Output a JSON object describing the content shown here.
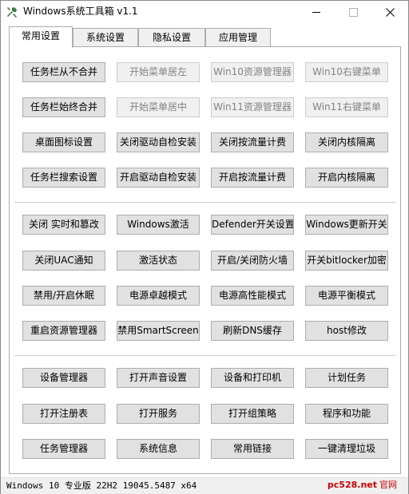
{
  "window": {
    "title": "Windows系统工具箱 v1.1"
  },
  "tabs": [
    {
      "label": "常用设置",
      "active": true
    },
    {
      "label": "系统设置",
      "active": false
    },
    {
      "label": "隐私设置",
      "active": false
    },
    {
      "label": "应用管理",
      "active": false
    }
  ],
  "buttons": {
    "g1": [
      {
        "label": "任务栏从不合并",
        "enabled": true
      },
      {
        "label": "开始菜单居左",
        "enabled": false
      },
      {
        "label": "Win10资源管理器",
        "enabled": false
      },
      {
        "label": "Win10右键菜单",
        "enabled": false
      },
      {
        "label": "任务栏始终合并",
        "enabled": true
      },
      {
        "label": "开始菜单居中",
        "enabled": false
      },
      {
        "label": "Win11资源管理器",
        "enabled": false
      },
      {
        "label": "Win11右键菜单",
        "enabled": false
      },
      {
        "label": "桌面图标设置",
        "enabled": true
      },
      {
        "label": "关闭驱动自检安装",
        "enabled": true
      },
      {
        "label": "关闭按流量计费",
        "enabled": true
      },
      {
        "label": "关闭内核隔离",
        "enabled": true
      },
      {
        "label": "任务栏搜索设置",
        "enabled": true
      },
      {
        "label": "开启驱动自检安装",
        "enabled": true
      },
      {
        "label": "开启按流量计费",
        "enabled": true
      },
      {
        "label": "开启内核隔离",
        "enabled": true
      }
    ],
    "g2": [
      {
        "label": "关闭 实时和篡改",
        "enabled": true
      },
      {
        "label": "Windows激活",
        "enabled": true
      },
      {
        "label": "Defender开关设置",
        "enabled": true
      },
      {
        "label": "Windows更新开关",
        "enabled": true
      },
      {
        "label": "关闭UAC通知",
        "enabled": true
      },
      {
        "label": "激活状态",
        "enabled": true
      },
      {
        "label": "开启/关闭防火墙",
        "enabled": true
      },
      {
        "label": "开关bitlocker加密",
        "enabled": true
      },
      {
        "label": "禁用/开启休眠",
        "enabled": true
      },
      {
        "label": "电源卓越模式",
        "enabled": true
      },
      {
        "label": "电源高性能模式",
        "enabled": true
      },
      {
        "label": "电源平衡模式",
        "enabled": true
      },
      {
        "label": "重启资源管理器",
        "enabled": true
      },
      {
        "label": "禁用SmartScreen",
        "enabled": true
      },
      {
        "label": "刷新DNS缓存",
        "enabled": true
      },
      {
        "label": "host修改",
        "enabled": true
      }
    ],
    "g3": [
      {
        "label": "设备管理器",
        "enabled": true
      },
      {
        "label": "打开声音设置",
        "enabled": true
      },
      {
        "label": "设备和打印机",
        "enabled": true
      },
      {
        "label": "计划任务",
        "enabled": true
      },
      {
        "label": "打开注册表",
        "enabled": true
      },
      {
        "label": "打开服务",
        "enabled": true
      },
      {
        "label": "打开组策略",
        "enabled": true
      },
      {
        "label": "程序和功能",
        "enabled": true
      },
      {
        "label": "任务管理器",
        "enabled": true
      },
      {
        "label": "系统信息",
        "enabled": true
      },
      {
        "label": "常用链接",
        "enabled": true
      },
      {
        "label": "一键清理垃圾",
        "enabled": true
      }
    ]
  },
  "status": {
    "text": "Windows 10 专业版 22H2 19045.5487 x64"
  },
  "brand": {
    "site": "pc528.net",
    "mark": "官网"
  },
  "colors": {
    "button_face": "#e1e1e1",
    "button_border": "#adadad",
    "disabled_text": "#838383",
    "brand_red": "#cc0000"
  }
}
